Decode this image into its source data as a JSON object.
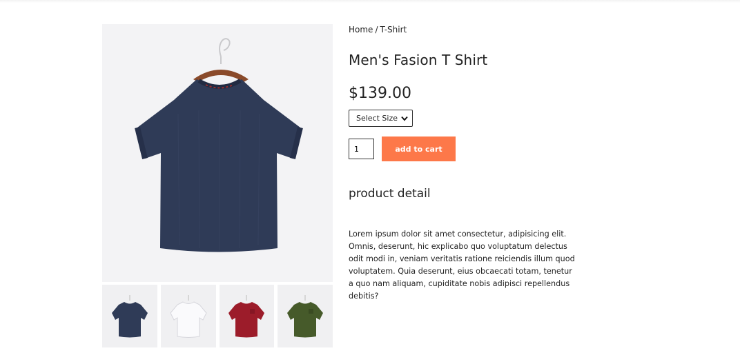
{
  "breadcrumb": {
    "home": "Home",
    "separator": "/",
    "current": "T-Shirt"
  },
  "product": {
    "title": "Men's Fasion T Shirt",
    "price": "$139.00",
    "size_select": {
      "selected": "Select Size"
    },
    "quantity": "1",
    "add_to_cart_label": "add to cart",
    "detail_heading": "product detail",
    "description": "Lorem ipsum dolor sit amet consectetur, adipisicing elit. Omnis, deserunt, hic explicabo quo voluptatum delectus odit modi in, veniam veritatis ratione reiciendis illum quod voluptatem. Quia deserunt, eius obcaecati totam, tenetur a quo nam aliquam, cupiditate nobis adipisci repellendus debitis?"
  },
  "gallery": {
    "main_color": "#2f3b57",
    "thumbnails": [
      {
        "name": "navy",
        "color": "#2f3b57"
      },
      {
        "name": "white",
        "color": "#f4f4f6"
      },
      {
        "name": "red",
        "color": "#9c1c2a"
      },
      {
        "name": "olive",
        "color": "#465a2a"
      }
    ]
  },
  "colors": {
    "accent": "#fd7849"
  }
}
